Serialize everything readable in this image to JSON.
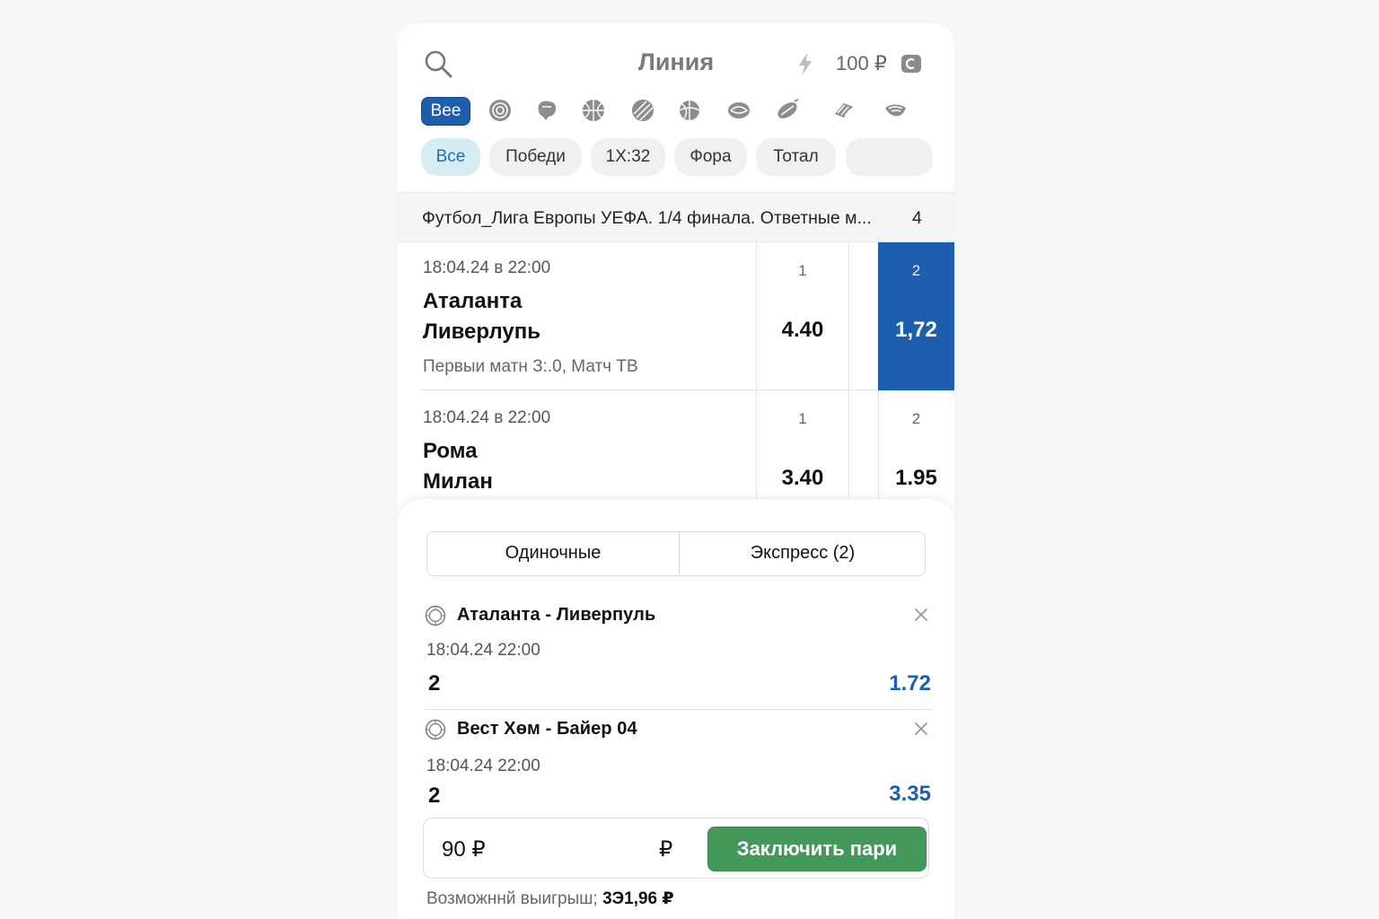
{
  "header": {
    "title": "Линия",
    "balance": "100 ₽"
  },
  "sports": {
    "all_label": "Вее",
    "icons": [
      "volleyball-icon",
      "hockey-icon",
      "basketball-icon",
      "tennis-icon",
      "football-icon",
      "handball-icon",
      "rugby-icon",
      "baseball-icon",
      "esports-icon"
    ]
  },
  "markets": [
    {
      "label": "Все",
      "active": true
    },
    {
      "label": "Победи"
    },
    {
      "label": "1X:32"
    },
    {
      "label": "Фора"
    },
    {
      "label": "Тотал"
    },
    {
      "label": ""
    }
  ],
  "league": {
    "name": "Футбол_Лига Европы УЕФА. 1/4 финала. Ответные м...",
    "count": "4"
  },
  "matches": [
    {
      "date": "18:04.24 в 22:00",
      "team1": "Аталанта",
      "team2": "Ливерлупь",
      "note": "Первыи матн З:.0, Матч ТВ",
      "label1": "1",
      "odd1": "4.40",
      "label2": "2",
      "odd2": "1,72",
      "selected": true
    },
    {
      "date": "18:04.24 в 22:00",
      "team1": "Рома",
      "team2": "Милан",
      "note": "",
      "label1": "1",
      "odd1": "3.40",
      "label2": "2",
      "odd2": "1.95",
      "selected": false
    }
  ],
  "slip": {
    "tab_single": "Одиночные",
    "tab_express": "Экспресс (2)",
    "bets": [
      {
        "title": "Аталанта - Ливерпуль",
        "date": "18:04.24 22:00",
        "outcome": "2",
        "odd": "1.72"
      },
      {
        "title": "Вест Хөм - Байер 04",
        "date": "18:04.24 22:00",
        "outcome": "2",
        "odd": "3.35"
      }
    ],
    "stake_value": "90 ₽",
    "currency": "₽",
    "place_label": "Заключить пари",
    "possible_label": "Возможннй выигрыш;",
    "possible_value": "3Э1,96 ₽"
  },
  "colors": {
    "accent": "#1d5fae",
    "green": "#44995a",
    "chip_active": "#d8ecf3"
  }
}
